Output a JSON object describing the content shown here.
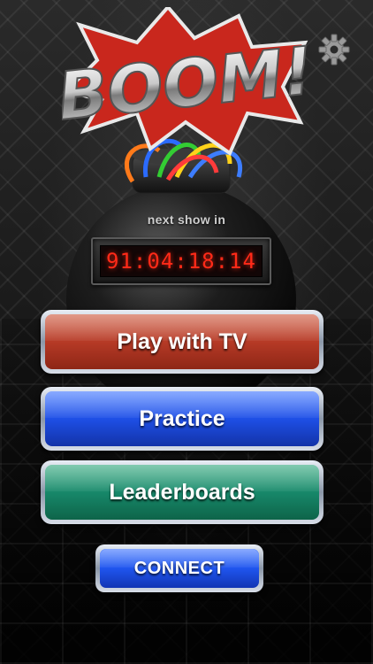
{
  "app": {
    "logo_text": "BOOM!"
  },
  "settings": {
    "icon": "gear-icon"
  },
  "countdown": {
    "label": "next show in",
    "time": "91:04:18:14"
  },
  "buttons": {
    "play_tv": "Play with TV",
    "practice": "Practice",
    "leaderboards": "Leaderboards",
    "connect": "CONNECT"
  },
  "colors": {
    "play_tv": "#b63a26",
    "practice": "#1e4fe6",
    "leaderboards": "#17886a",
    "connect": "#1f55ee",
    "timer_digits": "#ff2a18"
  }
}
